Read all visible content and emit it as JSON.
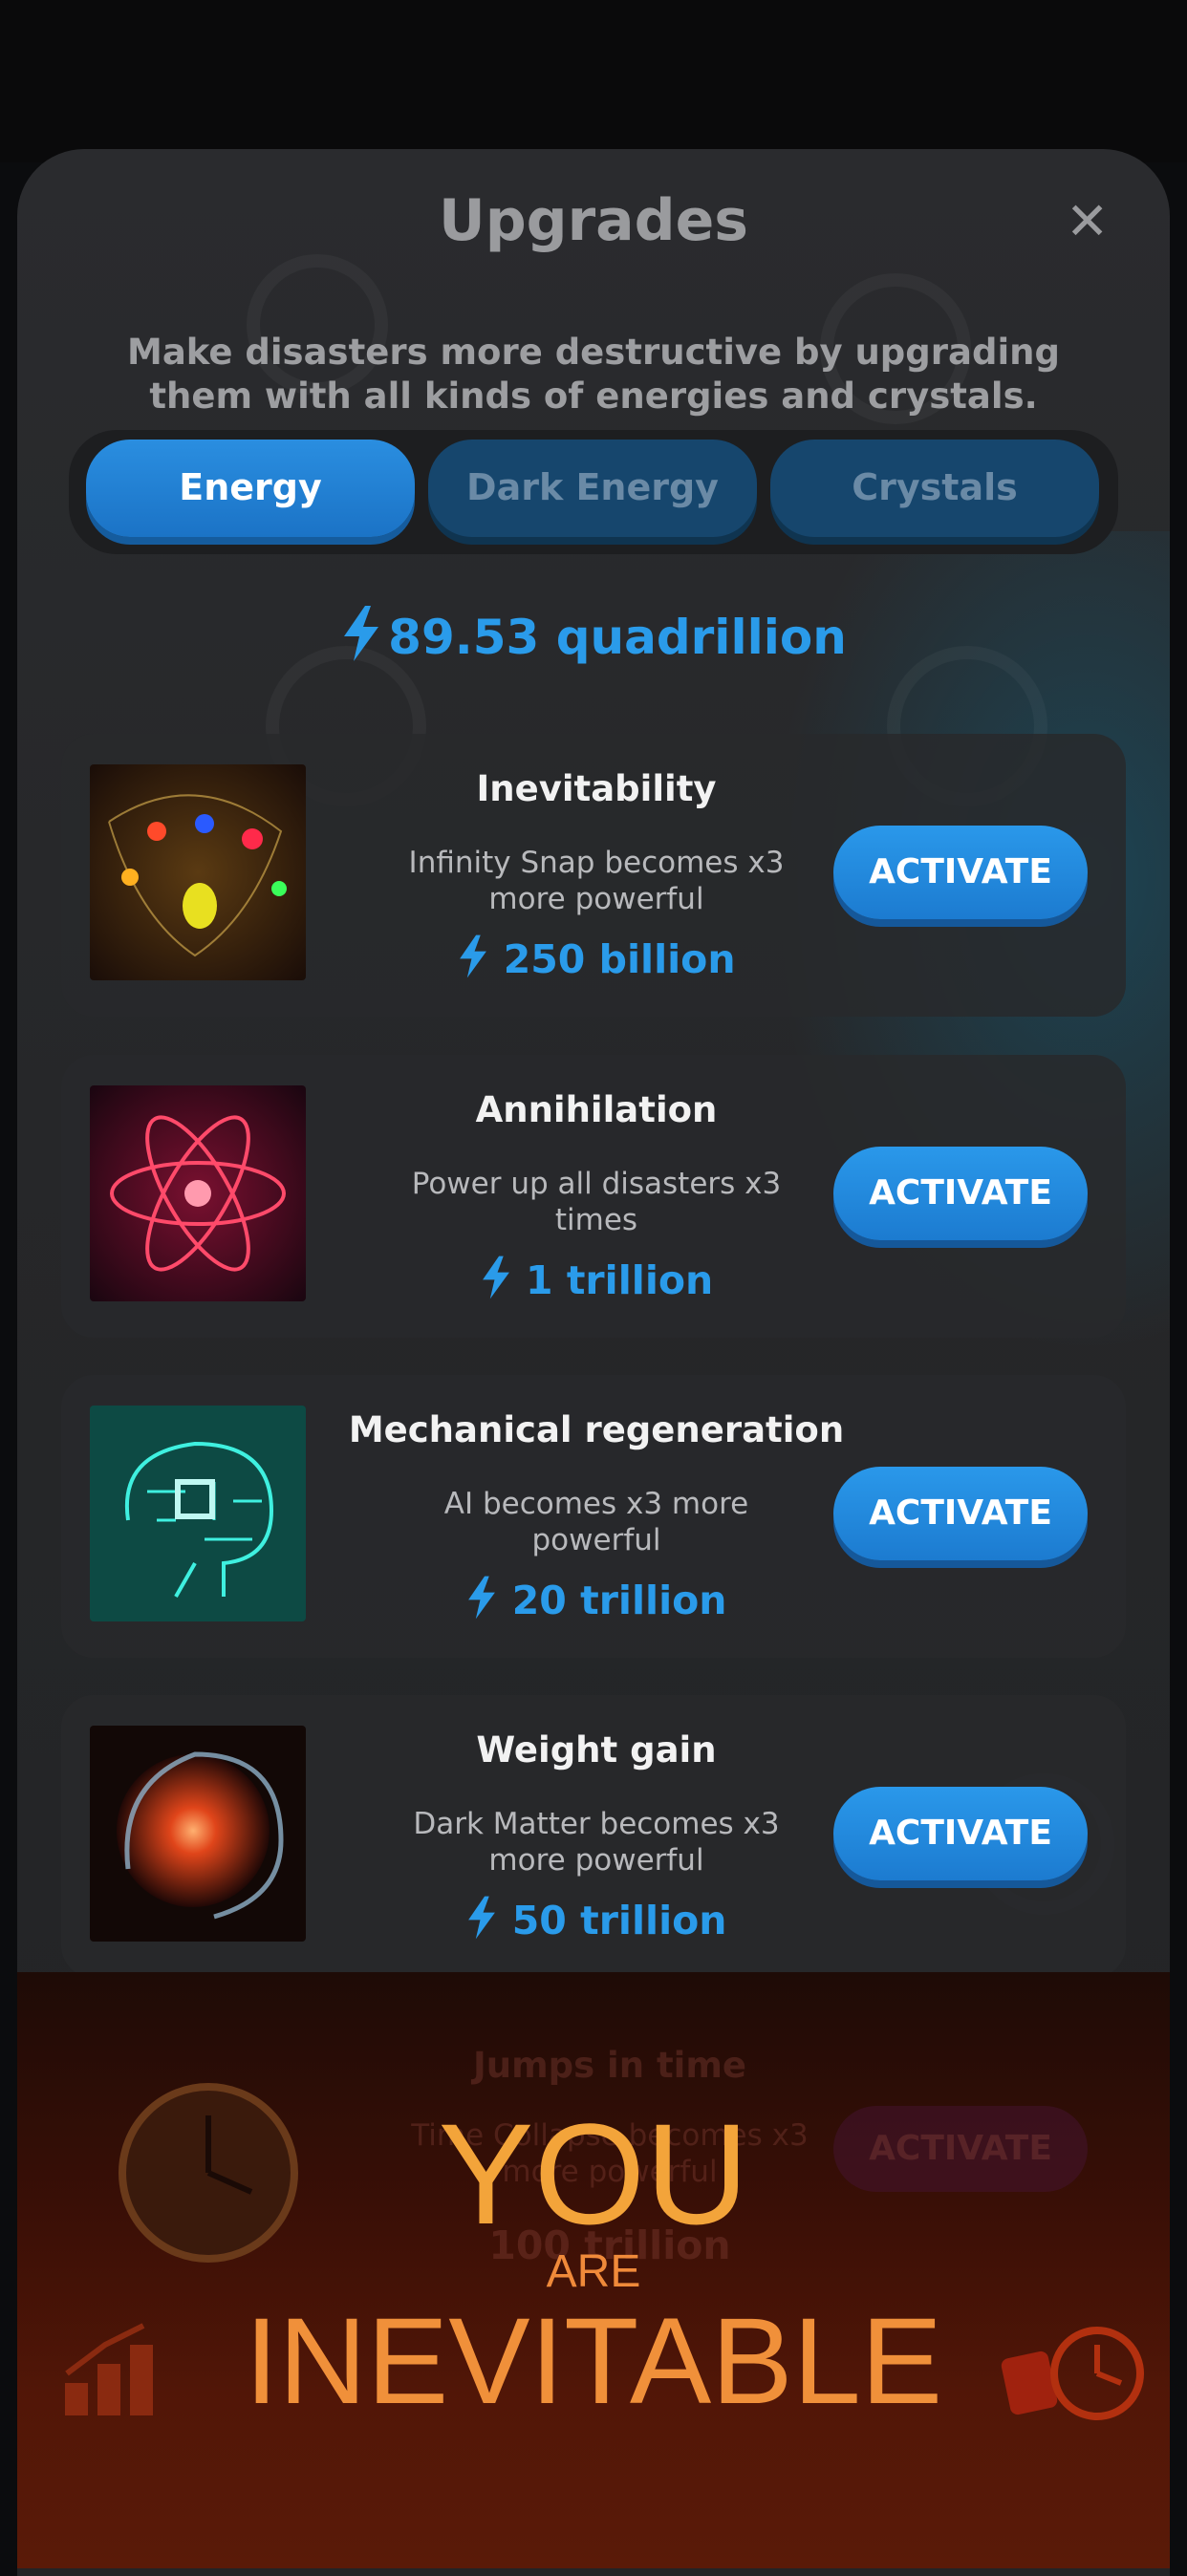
{
  "header": {
    "title": "Upgrades",
    "close_glyph": "✕"
  },
  "subtitle": "Make disasters more destructive by upgrading them with all kinds of energies and crystals.",
  "tabs": [
    {
      "label": "Energy",
      "active": true
    },
    {
      "label": "Dark Energy",
      "active": false
    },
    {
      "label": "Crystals",
      "active": false
    }
  ],
  "balance": {
    "icon": "lightning-bolt-icon",
    "value": "89.53 quadrillion"
  },
  "upgrades": [
    {
      "title": "Inevitability",
      "desc": "Infinity Snap becomes x3 more powerful",
      "cost": "250 billion",
      "button": "ACTIVATE",
      "image": "infinity-stones-image"
    },
    {
      "title": "Annihilation",
      "desc": "Power up all disasters x3 times",
      "cost": "1 trillion",
      "button": "ACTIVATE",
      "image": "atom-image"
    },
    {
      "title": "Mechanical regeneration",
      "desc": "AI becomes x3 more powerful",
      "cost": "20 trillion",
      "button": "ACTIVATE",
      "image": "circuit-brain-image"
    },
    {
      "title": "Weight gain",
      "desc": "Dark Matter becomes x3 more powerful",
      "cost": "50 trillion",
      "button": "ACTIVATE",
      "image": "dark-matter-orb-image"
    }
  ],
  "faded_card": {
    "title": "Jumps in time",
    "desc": "Time Collapse becomes x3 more powerful",
    "cost": "100 trillion",
    "button": "ACTIVATE"
  },
  "overlay": {
    "line1": "YOU",
    "line2": "ARE",
    "line3": "INEVITABLE"
  },
  "colors": {
    "accent": "#2a9bea",
    "panel": "#28292c",
    "overlay_text": "#f3a43a"
  }
}
